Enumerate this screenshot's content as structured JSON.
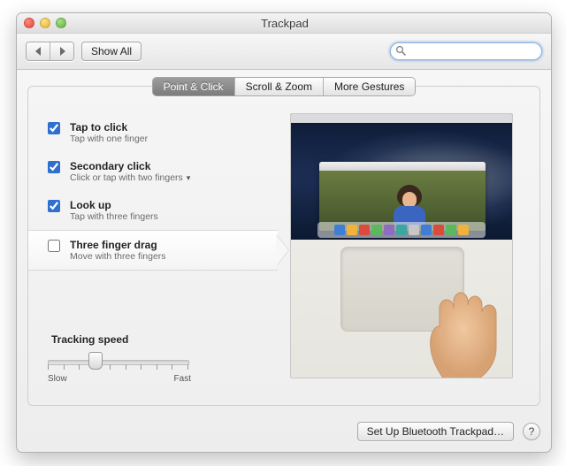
{
  "window": {
    "title": "Trackpad"
  },
  "toolbar": {
    "show_all": "Show All",
    "search_placeholder": ""
  },
  "tabs": [
    {
      "label": "Point & Click",
      "active": true
    },
    {
      "label": "Scroll & Zoom",
      "active": false
    },
    {
      "label": "More Gestures",
      "active": false
    }
  ],
  "options": [
    {
      "title": "Tap to click",
      "subtitle": "Tap with one finger",
      "checked": true,
      "dropdown": false,
      "selected": false
    },
    {
      "title": "Secondary click",
      "subtitle": "Click or tap with two fingers",
      "checked": true,
      "dropdown": true,
      "selected": false
    },
    {
      "title": "Look up",
      "subtitle": "Tap with three fingers",
      "checked": true,
      "dropdown": false,
      "selected": false
    },
    {
      "title": "Three finger drag",
      "subtitle": "Move with three fingers",
      "checked": false,
      "dropdown": false,
      "selected": true
    }
  ],
  "tracking": {
    "title": "Tracking speed",
    "slow": "Slow",
    "fast": "Fast",
    "value": 3,
    "max": 9
  },
  "bottom": {
    "bluetooth": "Set Up Bluetooth Trackpad…",
    "help": "?"
  },
  "dock_colors": [
    "#3f7ed6",
    "#f0b23a",
    "#d94b3c",
    "#5cb85c",
    "#8e6cc0",
    "#3ba7a0",
    "#c7c7c7",
    "#3f7ed6",
    "#d94b3c",
    "#5cb85c",
    "#f0b23a"
  ]
}
